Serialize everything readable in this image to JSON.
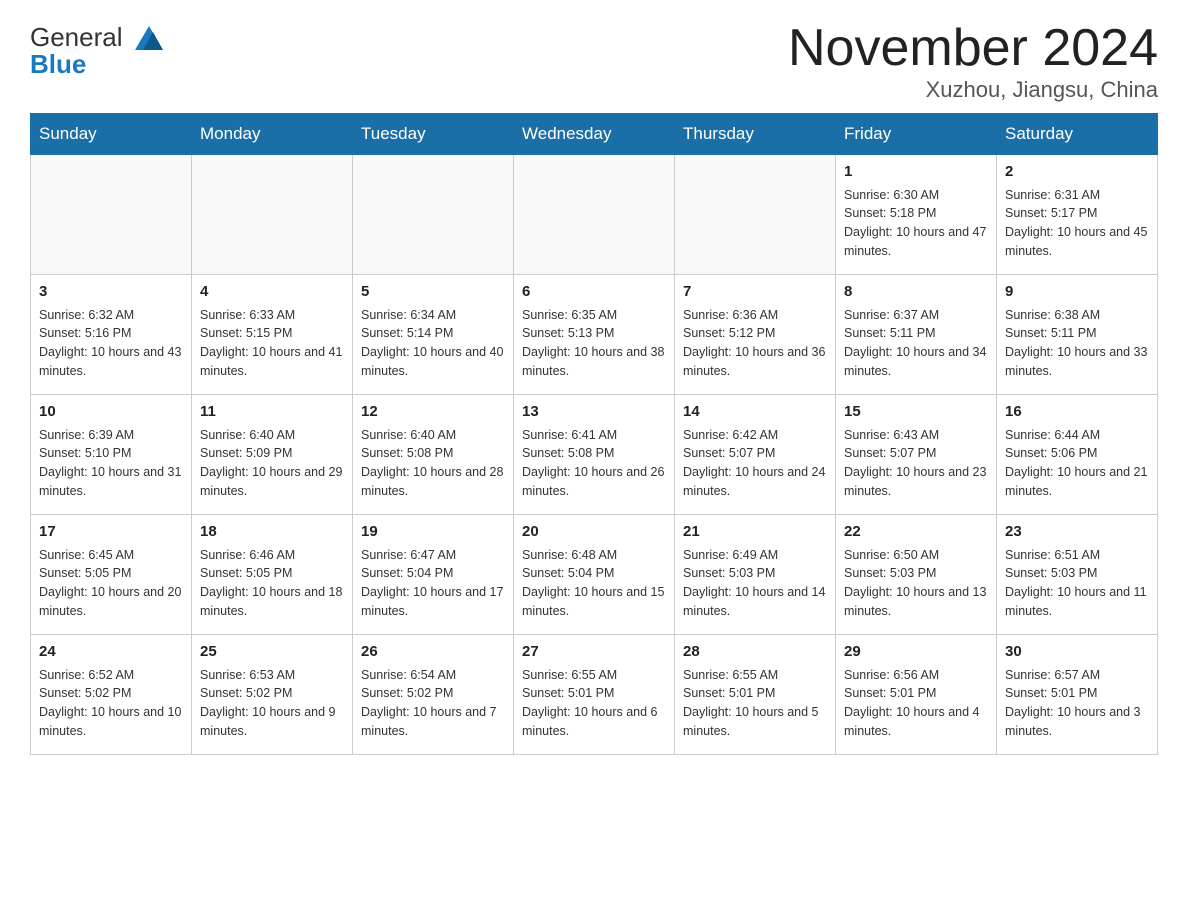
{
  "header": {
    "logo_general": "General",
    "logo_blue": "Blue",
    "month": "November 2024",
    "location": "Xuzhou, Jiangsu, China"
  },
  "days_of_week": [
    "Sunday",
    "Monday",
    "Tuesday",
    "Wednesday",
    "Thursday",
    "Friday",
    "Saturday"
  ],
  "weeks": [
    [
      {
        "day": "",
        "empty": true
      },
      {
        "day": "",
        "empty": true
      },
      {
        "day": "",
        "empty": true
      },
      {
        "day": "",
        "empty": true
      },
      {
        "day": "",
        "empty": true
      },
      {
        "day": "1",
        "sunrise": "Sunrise: 6:30 AM",
        "sunset": "Sunset: 5:18 PM",
        "daylight": "Daylight: 10 hours and 47 minutes."
      },
      {
        "day": "2",
        "sunrise": "Sunrise: 6:31 AM",
        "sunset": "Sunset: 5:17 PM",
        "daylight": "Daylight: 10 hours and 45 minutes."
      }
    ],
    [
      {
        "day": "3",
        "sunrise": "Sunrise: 6:32 AM",
        "sunset": "Sunset: 5:16 PM",
        "daylight": "Daylight: 10 hours and 43 minutes."
      },
      {
        "day": "4",
        "sunrise": "Sunrise: 6:33 AM",
        "sunset": "Sunset: 5:15 PM",
        "daylight": "Daylight: 10 hours and 41 minutes."
      },
      {
        "day": "5",
        "sunrise": "Sunrise: 6:34 AM",
        "sunset": "Sunset: 5:14 PM",
        "daylight": "Daylight: 10 hours and 40 minutes."
      },
      {
        "day": "6",
        "sunrise": "Sunrise: 6:35 AM",
        "sunset": "Sunset: 5:13 PM",
        "daylight": "Daylight: 10 hours and 38 minutes."
      },
      {
        "day": "7",
        "sunrise": "Sunrise: 6:36 AM",
        "sunset": "Sunset: 5:12 PM",
        "daylight": "Daylight: 10 hours and 36 minutes."
      },
      {
        "day": "8",
        "sunrise": "Sunrise: 6:37 AM",
        "sunset": "Sunset: 5:11 PM",
        "daylight": "Daylight: 10 hours and 34 minutes."
      },
      {
        "day": "9",
        "sunrise": "Sunrise: 6:38 AM",
        "sunset": "Sunset: 5:11 PM",
        "daylight": "Daylight: 10 hours and 33 minutes."
      }
    ],
    [
      {
        "day": "10",
        "sunrise": "Sunrise: 6:39 AM",
        "sunset": "Sunset: 5:10 PM",
        "daylight": "Daylight: 10 hours and 31 minutes."
      },
      {
        "day": "11",
        "sunrise": "Sunrise: 6:40 AM",
        "sunset": "Sunset: 5:09 PM",
        "daylight": "Daylight: 10 hours and 29 minutes."
      },
      {
        "day": "12",
        "sunrise": "Sunrise: 6:40 AM",
        "sunset": "Sunset: 5:08 PM",
        "daylight": "Daylight: 10 hours and 28 minutes."
      },
      {
        "day": "13",
        "sunrise": "Sunrise: 6:41 AM",
        "sunset": "Sunset: 5:08 PM",
        "daylight": "Daylight: 10 hours and 26 minutes."
      },
      {
        "day": "14",
        "sunrise": "Sunrise: 6:42 AM",
        "sunset": "Sunset: 5:07 PM",
        "daylight": "Daylight: 10 hours and 24 minutes."
      },
      {
        "day": "15",
        "sunrise": "Sunrise: 6:43 AM",
        "sunset": "Sunset: 5:07 PM",
        "daylight": "Daylight: 10 hours and 23 minutes."
      },
      {
        "day": "16",
        "sunrise": "Sunrise: 6:44 AM",
        "sunset": "Sunset: 5:06 PM",
        "daylight": "Daylight: 10 hours and 21 minutes."
      }
    ],
    [
      {
        "day": "17",
        "sunrise": "Sunrise: 6:45 AM",
        "sunset": "Sunset: 5:05 PM",
        "daylight": "Daylight: 10 hours and 20 minutes."
      },
      {
        "day": "18",
        "sunrise": "Sunrise: 6:46 AM",
        "sunset": "Sunset: 5:05 PM",
        "daylight": "Daylight: 10 hours and 18 minutes."
      },
      {
        "day": "19",
        "sunrise": "Sunrise: 6:47 AM",
        "sunset": "Sunset: 5:04 PM",
        "daylight": "Daylight: 10 hours and 17 minutes."
      },
      {
        "day": "20",
        "sunrise": "Sunrise: 6:48 AM",
        "sunset": "Sunset: 5:04 PM",
        "daylight": "Daylight: 10 hours and 15 minutes."
      },
      {
        "day": "21",
        "sunrise": "Sunrise: 6:49 AM",
        "sunset": "Sunset: 5:03 PM",
        "daylight": "Daylight: 10 hours and 14 minutes."
      },
      {
        "day": "22",
        "sunrise": "Sunrise: 6:50 AM",
        "sunset": "Sunset: 5:03 PM",
        "daylight": "Daylight: 10 hours and 13 minutes."
      },
      {
        "day": "23",
        "sunrise": "Sunrise: 6:51 AM",
        "sunset": "Sunset: 5:03 PM",
        "daylight": "Daylight: 10 hours and 11 minutes."
      }
    ],
    [
      {
        "day": "24",
        "sunrise": "Sunrise: 6:52 AM",
        "sunset": "Sunset: 5:02 PM",
        "daylight": "Daylight: 10 hours and 10 minutes."
      },
      {
        "day": "25",
        "sunrise": "Sunrise: 6:53 AM",
        "sunset": "Sunset: 5:02 PM",
        "daylight": "Daylight: 10 hours and 9 minutes."
      },
      {
        "day": "26",
        "sunrise": "Sunrise: 6:54 AM",
        "sunset": "Sunset: 5:02 PM",
        "daylight": "Daylight: 10 hours and 7 minutes."
      },
      {
        "day": "27",
        "sunrise": "Sunrise: 6:55 AM",
        "sunset": "Sunset: 5:01 PM",
        "daylight": "Daylight: 10 hours and 6 minutes."
      },
      {
        "day": "28",
        "sunrise": "Sunrise: 6:55 AM",
        "sunset": "Sunset: 5:01 PM",
        "daylight": "Daylight: 10 hours and 5 minutes."
      },
      {
        "day": "29",
        "sunrise": "Sunrise: 6:56 AM",
        "sunset": "Sunset: 5:01 PM",
        "daylight": "Daylight: 10 hours and 4 minutes."
      },
      {
        "day": "30",
        "sunrise": "Sunrise: 6:57 AM",
        "sunset": "Sunset: 5:01 PM",
        "daylight": "Daylight: 10 hours and 3 minutes."
      }
    ]
  ]
}
